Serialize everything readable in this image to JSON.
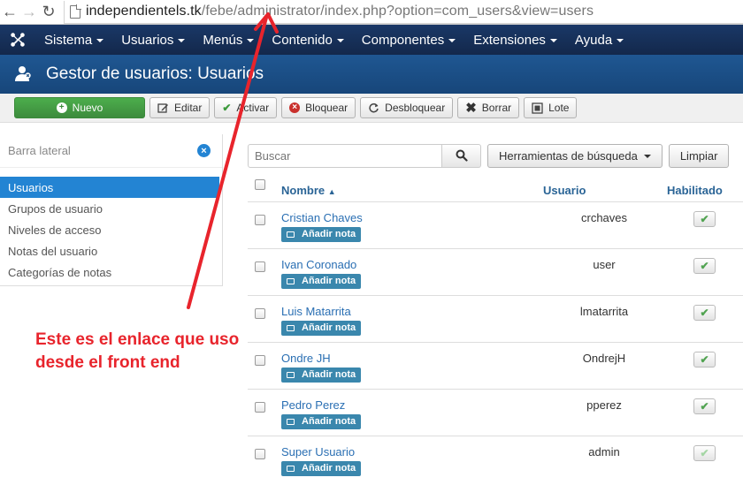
{
  "browser": {
    "url_host": "independientels.tk",
    "url_path": "/febe/administrator/index.php?option=com_users&view=users"
  },
  "topnav": {
    "items": [
      "Sistema",
      "Usuarios",
      "Menús",
      "Contenido",
      "Componentes",
      "Extensiones",
      "Ayuda"
    ]
  },
  "page": {
    "title": "Gestor de usuarios: Usuarios"
  },
  "toolbar": {
    "new": "Nuevo",
    "edit": "Editar",
    "activate": "Activar",
    "block": "Bloquear",
    "unblock": "Desbloquear",
    "delete": "Borrar",
    "batch": "Lote"
  },
  "sidebar": {
    "title": "Barra lateral",
    "items": [
      {
        "label": "Usuarios",
        "active": true
      },
      {
        "label": "Grupos de usuario",
        "active": false
      },
      {
        "label": "Niveles de acceso",
        "active": false
      },
      {
        "label": "Notas del usuario",
        "active": false
      },
      {
        "label": "Categorías de notas",
        "active": false
      }
    ]
  },
  "search": {
    "placeholder": "Buscar",
    "tools_label": "Herramientas de búsqueda",
    "clear_label": "Limpiar"
  },
  "table": {
    "headers": {
      "name": "Nombre",
      "username": "Usuario",
      "enabled": "Habilitado"
    },
    "note_label": "Añadir nota",
    "rows": [
      {
        "name": "Cristian Chaves",
        "username": "crchaves",
        "enabled": true
      },
      {
        "name": "Ivan Coronado",
        "username": "user",
        "enabled": true
      },
      {
        "name": "Luis Matarrita",
        "username": "lmatarrita",
        "enabled": true
      },
      {
        "name": "Ondre JH",
        "username": "OndrejH",
        "enabled": true
      },
      {
        "name": "Pedro Perez",
        "username": "pperez",
        "enabled": true
      },
      {
        "name": "Super Usuario",
        "username": "admin",
        "enabled": true
      }
    ]
  },
  "annotation": {
    "line1": "Este es el enlace que uso",
    "line2": "desde el front end",
    "color": "#e8242c"
  }
}
